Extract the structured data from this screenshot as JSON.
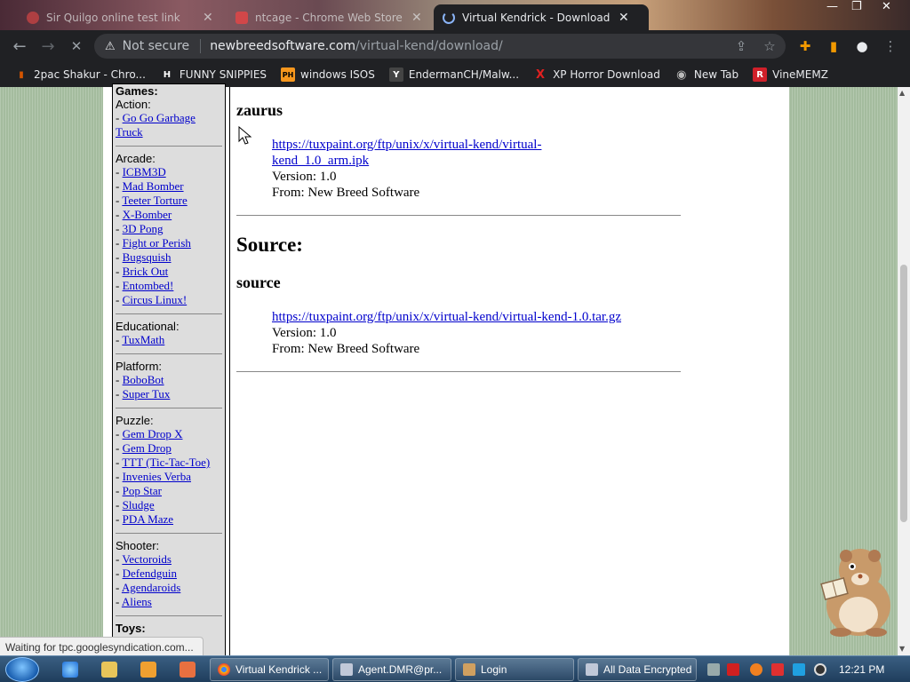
{
  "browser": {
    "tabs": [
      {
        "title": "Sir Quilgo online test link",
        "active": false
      },
      {
        "title": "ntcage - Chrome Web Store",
        "active": false
      },
      {
        "title": "Virtual Kendrick - Download [Ne",
        "active": true
      }
    ],
    "window_controls": {
      "minimize": "—",
      "maximize": "❐",
      "close": "✕"
    },
    "toolbar": {
      "back": "←",
      "forward": "→",
      "stop": "✕",
      "security_label": "Not secure",
      "url_host": "newbreedsoftware.com",
      "url_path": "/virtual-kend/download/"
    },
    "bookmarks": [
      {
        "label": "2pac Shakur - Chro...",
        "icon_text": "▮",
        "icon_color": "#d35400"
      },
      {
        "label": "FUNNY SNIPPIES",
        "icon_text": "H",
        "icon_color": "#ffffff"
      },
      {
        "label": "windows ISOS",
        "icon_text": "PH",
        "icon_color": "#f7971d"
      },
      {
        "label": "EndermanCH/Malw...",
        "icon_text": "Y",
        "icon_color": "#444444"
      },
      {
        "label": "XP Horror Download",
        "icon_text": "X",
        "icon_color": "#e02020"
      },
      {
        "label": "New Tab",
        "icon_text": "◉",
        "icon_color": "#bbbbbb"
      },
      {
        "label": "VineMEMZ",
        "icon_text": "R",
        "icon_color": "#d0202a"
      }
    ],
    "status": "Waiting for tpc.googlesyndication.com..."
  },
  "sidebar": {
    "games_title": "Games:",
    "sections": [
      {
        "title": "Action:",
        "items": [
          "Go Go Garbage Truck"
        ]
      },
      {
        "title": "Arcade:",
        "items": [
          "ICBM3D",
          "Mad Bomber",
          "Teeter Torture",
          "X-Bomber",
          "3D Pong",
          "Fight or Perish",
          "Bugsquish",
          "Brick Out",
          "Entombed!",
          "Circus Linux!"
        ]
      },
      {
        "title": "Educational:",
        "items": [
          "TuxMath"
        ]
      },
      {
        "title": "Platform:",
        "items": [
          "BoboBot",
          "Super Tux"
        ]
      },
      {
        "title": "Puzzle:",
        "items": [
          "Gem Drop X",
          "Gem Drop",
          "TTT (Tic-Tac-Toe)",
          "Invenies Verba",
          "Pop Star",
          "Sludge",
          "PDA Maze"
        ]
      },
      {
        "title": "Shooter:",
        "items": [
          "Vectoroids",
          "Defendguin",
          "Agendaroids",
          "Aliens"
        ]
      }
    ],
    "toys_title": "Toys:"
  },
  "main": {
    "zaurus": {
      "heading": "zaurus",
      "link_line1": "https://tuxpaint.org/ftp/unix/x/virtual-kend/virtual-",
      "link_line2": "kend_1.0_arm.ipk",
      "version": "Version: 1.0",
      "from": "From: New Breed Software"
    },
    "source_section": "Source:",
    "source": {
      "heading": "source",
      "link": "https://tuxpaint.org/ftp/unix/x/virtual-kend/virtual-kend-1.0.tar.gz",
      "version": "Version: 1.0",
      "from": "From: New Breed Software"
    }
  },
  "taskbar": {
    "tasks": [
      {
        "label": "Virtual Kendrick ...",
        "icon_color": "#e8453c"
      },
      {
        "label": "Agent.DMR@pr...",
        "icon_color": "#c0c8d8"
      },
      {
        "label": "Login",
        "icon_color": "#d0a060"
      },
      {
        "label": "All Data Encrypted",
        "icon_color": "#c0c8d8"
      }
    ],
    "clock": "12:21 PM"
  }
}
